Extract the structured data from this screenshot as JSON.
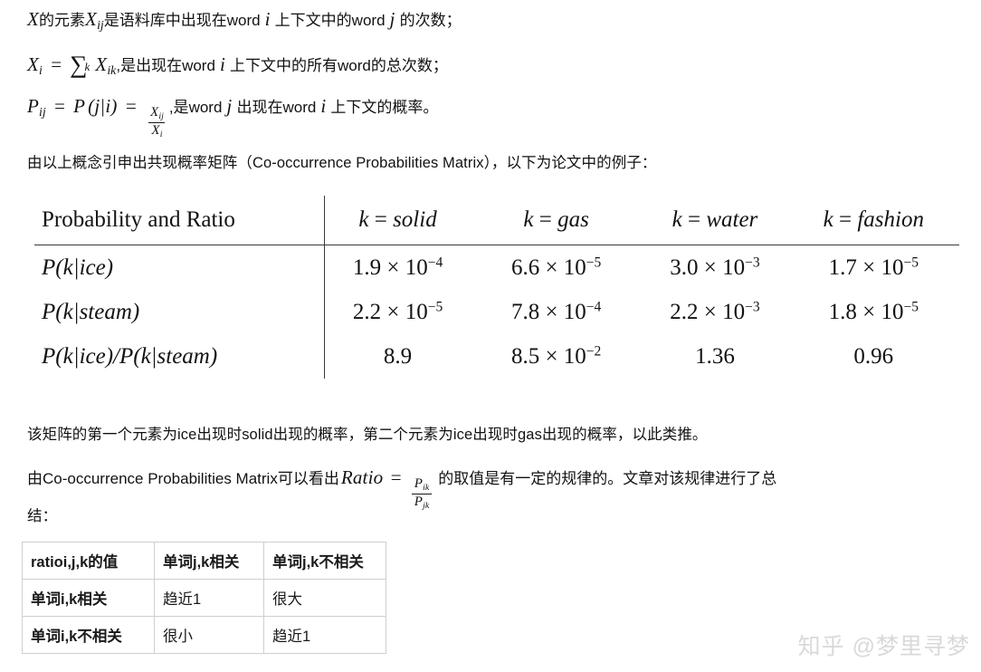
{
  "document": {
    "formulas": [
      {
        "id": "x-ij-definition",
        "lead_var": "X",
        "text_a": "的元素",
        "var_b": "X",
        "var_b_sub": "ij",
        "text_b": "是语料库中出现在",
        "word_1": "word",
        "idx_1": "i",
        "text_c": "上下文中的",
        "word_2": "word",
        "idx_2": "j",
        "text_d": "的次数；"
      },
      {
        "id": "x-i-definition",
        "lhs": "X",
        "lhs_sub": "i",
        "eq": "=",
        "sum": "∑",
        "sum_sub": "k",
        "rhs": "X",
        "rhs_sub": "ik",
        "text_a": ",是出现在",
        "word_1": "word",
        "idx_1": "i",
        "text_b": "上下文中的所有",
        "word_2": "word",
        "text_c": "的总次数；"
      },
      {
        "id": "p-ij-definition",
        "lhs": "P",
        "lhs_sub": "ij",
        "eq1": "=",
        "pfunc": "P",
        "cond": "(j|i)",
        "eq2": "=",
        "frac_num": "X",
        "frac_num_sub": "ij",
        "frac_den": "X",
        "frac_den_sub": "i",
        "text_a": ",是",
        "word_1": "word",
        "idx_1": "j",
        "text_b": "出现在",
        "word_2": "word",
        "idx_2": "i",
        "text_c": "上下文的概率。"
      }
    ],
    "intro_paragraph": "由以上概念引申出共现概率矩阵（Co-occurrence Probabilities Matrix），以下为论文中的例子：",
    "after_table_paragraph": "该矩阵的第一个元素为ice出现时solid出现的概率，第二个元素为ice出现时gas出现的概率，以此类推。",
    "ratio_paragraph": {
      "pre": "由Co-occurrence Probabilities Matrix可以看出",
      "ratio_word": "Ratio",
      "eq": "=",
      "frac_num": "P",
      "frac_num_sub": "ik",
      "frac_den": "P",
      "frac_den_sub": "jk",
      "post_a": "的取值是有一定的规律的。",
      "link_text": "文章",
      "post_b": "对该规律进行了总",
      "line2": "结："
    }
  },
  "paper_table": {
    "type": "table",
    "corner_header": "Probability and Ratio",
    "column_headers": [
      {
        "k": "k",
        "eq": "=",
        "value": "solid"
      },
      {
        "k": "k",
        "eq": "=",
        "value": "gas"
      },
      {
        "k": "k",
        "eq": "=",
        "value": "water"
      },
      {
        "k": "k",
        "eq": "=",
        "value": "fashion"
      }
    ],
    "rows": [
      {
        "label_parts": {
          "p": "P",
          "open": "(",
          "k": "k",
          "bar": "|",
          "word": "ice",
          "close": ")"
        },
        "label_plain": "P(k|ice)",
        "cells": [
          {
            "mantissa": "1.9",
            "times": "×",
            "base": "10",
            "exp": "−4",
            "plain": "1.9 × 10⁻⁴"
          },
          {
            "mantissa": "6.6",
            "times": "×",
            "base": "10",
            "exp": "−5",
            "plain": "6.6 × 10⁻⁵"
          },
          {
            "mantissa": "3.0",
            "times": "×",
            "base": "10",
            "exp": "−3",
            "plain": "3.0 × 10⁻³"
          },
          {
            "mantissa": "1.7",
            "times": "×",
            "base": "10",
            "exp": "−5",
            "plain": "1.7 × 10⁻⁵"
          }
        ]
      },
      {
        "label_parts": {
          "p": "P",
          "open": "(",
          "k": "k",
          "bar": "|",
          "word": "steam",
          "close": ")"
        },
        "label_plain": "P(k|steam)",
        "cells": [
          {
            "mantissa": "2.2",
            "times": "×",
            "base": "10",
            "exp": "−5",
            "plain": "2.2 × 10⁻⁵"
          },
          {
            "mantissa": "7.8",
            "times": "×",
            "base": "10",
            "exp": "−4",
            "plain": "7.8 × 10⁻⁴"
          },
          {
            "mantissa": "2.2",
            "times": "×",
            "base": "10",
            "exp": "−3",
            "plain": "2.2 × 10⁻³"
          },
          {
            "mantissa": "1.8",
            "times": "×",
            "base": "10",
            "exp": "−5",
            "plain": "1.8 × 10⁻⁵"
          }
        ]
      },
      {
        "label_parts": {
          "p": "P",
          "open": "(",
          "k": "k",
          "bar": "|",
          "word": "ice",
          "close": ")/P(",
          "word2": "steam",
          "close2": ")"
        },
        "label_plain": "P(k|ice)/P(k|steam)",
        "cells": [
          {
            "mantissa": "8.9",
            "times": "",
            "base": "",
            "exp": "",
            "plain": "8.9"
          },
          {
            "mantissa": "8.5",
            "times": "×",
            "base": "10",
            "exp": "−2",
            "plain": "8.5 × 10⁻²"
          },
          {
            "mantissa": "1.36",
            "times": "",
            "base": "",
            "exp": "",
            "plain": "1.36"
          },
          {
            "mantissa": "0.96",
            "times": "",
            "base": "",
            "exp": "",
            "plain": "0.96"
          }
        ]
      }
    ]
  },
  "ratio_table": {
    "type": "table",
    "headers": [
      "ratioi,j,k的值",
      "单词j,k相关",
      "单词j,k不相关"
    ],
    "rows": [
      {
        "label": "单词i,k相关",
        "values": [
          "趋近1",
          "很大"
        ]
      },
      {
        "label": "单词i,k不相关",
        "values": [
          "很小",
          "趋近1"
        ]
      }
    ]
  },
  "watermark": {
    "text": "知乎 @梦里寻梦",
    "color": "#d8d9da"
  }
}
